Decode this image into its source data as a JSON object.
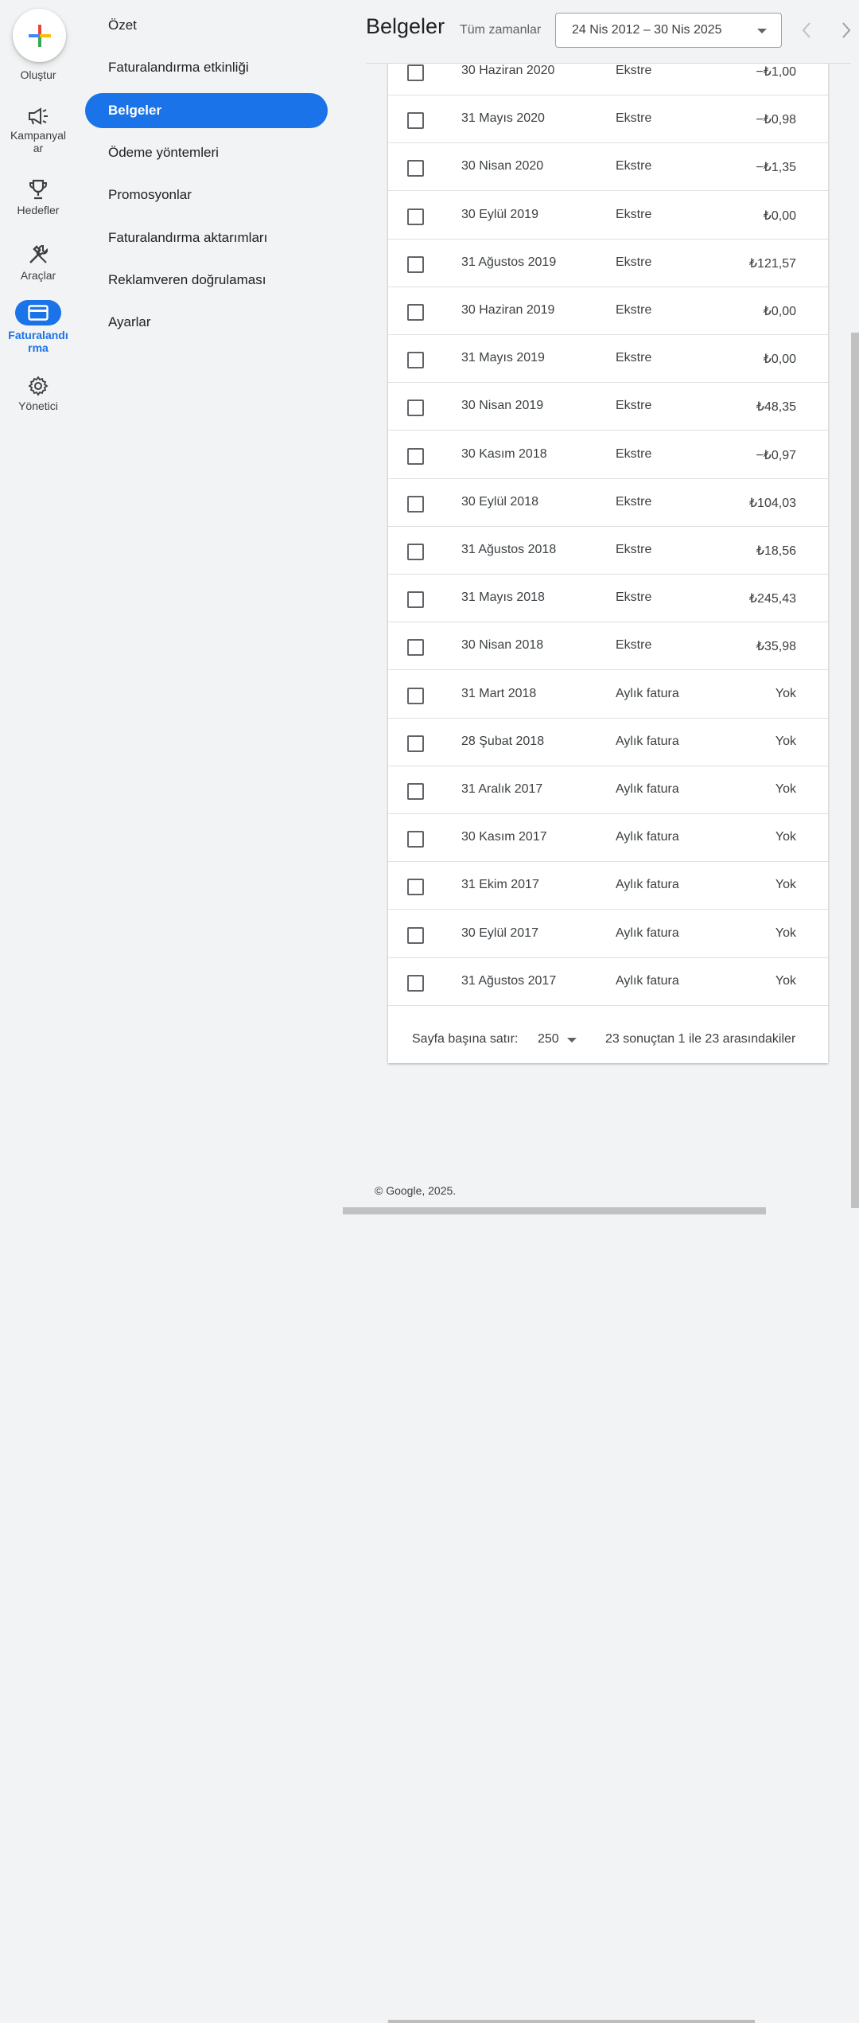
{
  "rail": {
    "create_label": "Oluştur",
    "items": [
      {
        "label": "Kampanyal\nar",
        "icon": "megaphone-icon"
      },
      {
        "label": "Hedefler",
        "icon": "trophy-icon"
      },
      {
        "label": "Araçlar",
        "icon": "tools-icon"
      },
      {
        "label": "Faturalandı\nrma",
        "icon": "credit-card-icon",
        "active": true
      },
      {
        "label": "Yönetici",
        "icon": "gear-icon"
      }
    ]
  },
  "subnav": {
    "items": [
      {
        "label": "Özet"
      },
      {
        "label": "Faturalandırma etkinliği"
      },
      {
        "label": "Belgeler",
        "active": true
      },
      {
        "label": "Ödeme yöntemleri"
      },
      {
        "label": "Promosyonlar"
      },
      {
        "label": "Faturalandırma aktarımları"
      },
      {
        "label": "Reklamveren doğrulaması"
      },
      {
        "label": "Ayarlar"
      }
    ]
  },
  "header": {
    "title": "Belgeler",
    "range_label": "Tüm zamanlar",
    "date_range": "24 Nis 2012 – 30 Nis 2025"
  },
  "table": {
    "rows": [
      {
        "date": "30 Haziran 2020",
        "type": "Ekstre",
        "amount": "−₺1,00"
      },
      {
        "date": "31 Mayıs 2020",
        "type": "Ekstre",
        "amount": "−₺0,98"
      },
      {
        "date": "30 Nisan 2020",
        "type": "Ekstre",
        "amount": "−₺1,35"
      },
      {
        "date": "30 Eylül 2019",
        "type": "Ekstre",
        "amount": "₺0,00"
      },
      {
        "date": "31 Ağustos 2019",
        "type": "Ekstre",
        "amount": "₺121,57"
      },
      {
        "date": "30 Haziran 2019",
        "type": "Ekstre",
        "amount": "₺0,00"
      },
      {
        "date": "31 Mayıs 2019",
        "type": "Ekstre",
        "amount": "₺0,00"
      },
      {
        "date": "30 Nisan 2019",
        "type": "Ekstre",
        "amount": "₺48,35"
      },
      {
        "date": "30 Kasım 2018",
        "type": "Ekstre",
        "amount": "−₺0,97"
      },
      {
        "date": "30 Eylül 2018",
        "type": "Ekstre",
        "amount": "₺104,03"
      },
      {
        "date": "31 Ağustos 2018",
        "type": "Ekstre",
        "amount": "₺18,56"
      },
      {
        "date": "31 Mayıs 2018",
        "type": "Ekstre",
        "amount": "₺245,43"
      },
      {
        "date": "30 Nisan 2018",
        "type": "Ekstre",
        "amount": "₺35,98"
      },
      {
        "date": "31 Mart 2018",
        "type": "Aylık fatura",
        "amount": "Yok"
      },
      {
        "date": "28 Şubat 2018",
        "type": "Aylık fatura",
        "amount": "Yok"
      },
      {
        "date": "31 Aralık 2017",
        "type": "Aylık fatura",
        "amount": "Yok"
      },
      {
        "date": "30 Kasım 2017",
        "type": "Aylık fatura",
        "amount": "Yok"
      },
      {
        "date": "31 Ekim 2017",
        "type": "Aylık fatura",
        "amount": "Yok"
      },
      {
        "date": "30 Eylül 2017",
        "type": "Aylık fatura",
        "amount": "Yok"
      },
      {
        "date": "31 Ağustos 2017",
        "type": "Aylık fatura",
        "amount": "Yok"
      }
    ],
    "rows_per_page_label": "Sayfa başına satır:",
    "rows_per_page_value": "250",
    "results_label": "23 sonuçtan 1 ile 23 arasındakiler"
  },
  "footer": {
    "copyright": "© Google, 2025."
  }
}
